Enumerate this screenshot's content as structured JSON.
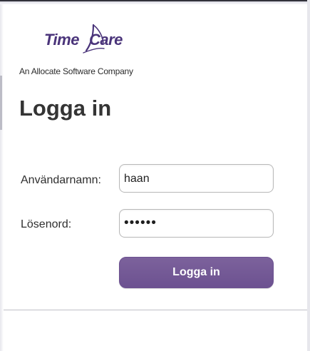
{
  "brand": {
    "logo_left": "Time",
    "logo_right": "Care",
    "tagline": "An Allocate Software Company"
  },
  "page": {
    "title": "Logga in"
  },
  "form": {
    "username_label": "Användarnamn:",
    "username_value": "haan",
    "password_label": "Lösenord:",
    "password_value": "••••••",
    "submit_label": "Logga in"
  },
  "colors": {
    "brand": "#4a347a",
    "button": "#70558f",
    "text": "#343434",
    "border": "#b8b8b8"
  },
  "icons": {
    "logo_mark": "swoosh-logo-icon"
  }
}
